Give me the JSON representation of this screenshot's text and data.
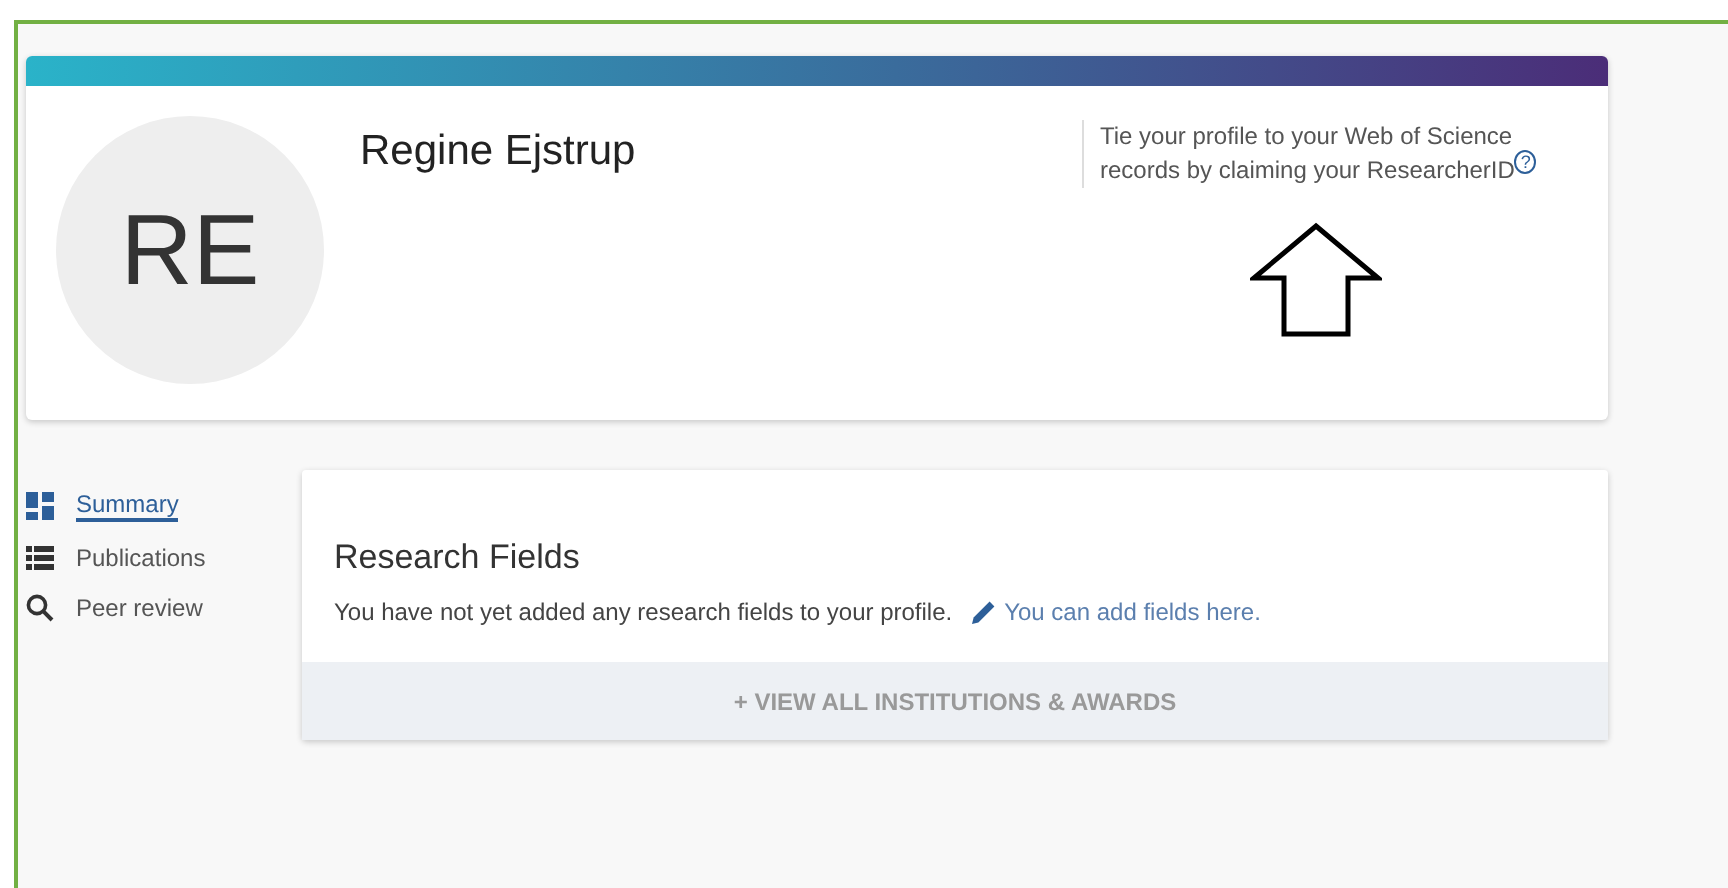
{
  "profile": {
    "initials": "RE",
    "name": "Regine Ejstrup",
    "claim_text": "Tie your profile to your Web of Science records by claiming your ResearcherID",
    "help_mark": "?"
  },
  "nav": [
    {
      "label": "Summary",
      "kind": "summary",
      "selected": true
    },
    {
      "label": "Publications",
      "kind": "list",
      "selected": false
    },
    {
      "label": "Peer review",
      "kind": "search",
      "selected": false
    }
  ],
  "research_fields": {
    "title": "Research Fields",
    "message": "You have not yet added any research fields to your profile.",
    "add_link": "You can add fields here.",
    "footer_button": "+ VIEW ALL INSTITUTIONS & AWARDS"
  }
}
